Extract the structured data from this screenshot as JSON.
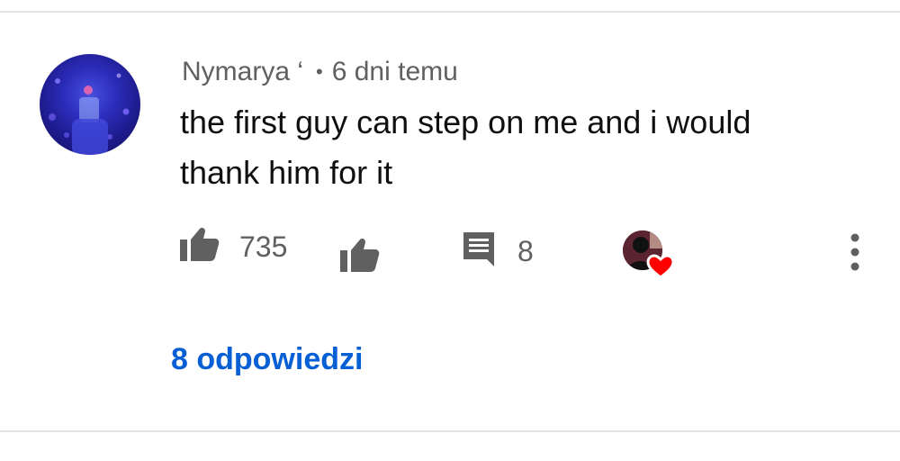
{
  "comment": {
    "author": "Nymarya ‘",
    "separator": "•",
    "timestamp": "6 dni temu",
    "text_lines": [
      "the first guy can step on me and i would",
      "thank him for it"
    ]
  },
  "actions": {
    "like_count": "735",
    "reply_count": "8"
  },
  "replies_link": "8 odpowiedzi",
  "colors": {
    "link": "#065fd4",
    "secondary_text": "#606060",
    "primary_text": "#0f0f0f",
    "heart": "#ff0000",
    "divider": "#e3e3e3"
  },
  "icons": {
    "avatar": "user-avatar",
    "like": "thumbs-up-icon",
    "dislike": "thumbs-down-icon",
    "reply": "comment-icon",
    "creator_heart": "creator-heart-icon",
    "more": "more-vertical-icon"
  }
}
